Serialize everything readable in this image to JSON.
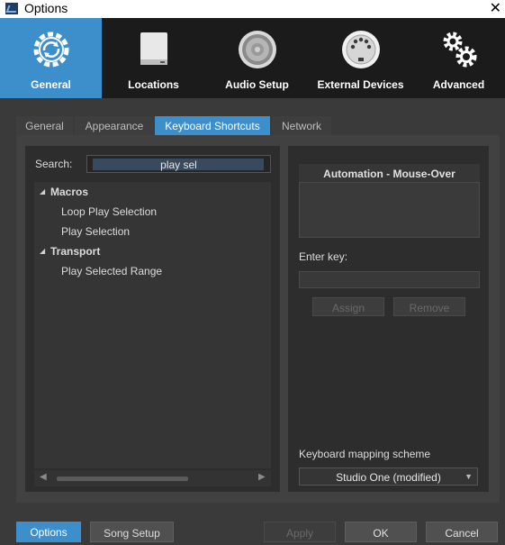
{
  "window": {
    "title": "Options",
    "close_glyph": "✕"
  },
  "categories": [
    {
      "label": "General",
      "icon": "gear-refresh-icon",
      "active": true
    },
    {
      "label": "Locations",
      "icon": "drive-icon",
      "active": false
    },
    {
      "label": "Audio Setup",
      "icon": "speaker-icon",
      "active": false
    },
    {
      "label": "External Devices",
      "icon": "midi-port-icon",
      "active": false
    },
    {
      "label": "Advanced",
      "icon": "gears-icon",
      "active": false
    }
  ],
  "tabs": [
    {
      "label": "General",
      "active": false
    },
    {
      "label": "Appearance",
      "active": false
    },
    {
      "label": "Keyboard Shortcuts",
      "active": true
    },
    {
      "label": "Network",
      "active": false
    }
  ],
  "search": {
    "label": "Search:",
    "value": "play sel"
  },
  "tree": {
    "groups": [
      {
        "label": "Macros",
        "items": [
          "Loop Play Selection",
          "Play Selection"
        ]
      },
      {
        "label": "Transport",
        "items": [
          "Play Selected Range"
        ]
      }
    ]
  },
  "details": {
    "header": "Automation - Mouse-Over",
    "enter_key_label": "Enter key:",
    "assign_label": "Assign",
    "remove_label": "Remove",
    "scheme_label": "Keyboard mapping scheme",
    "scheme_value": "Studio One (modified)"
  },
  "footer": {
    "options": "Options",
    "song_setup": "Song Setup",
    "apply": "Apply",
    "ok": "OK",
    "cancel": "Cancel"
  },
  "colors": {
    "accent": "#3d8fcc",
    "background": "#3a3a3a",
    "panel": "#2d2d2d"
  }
}
